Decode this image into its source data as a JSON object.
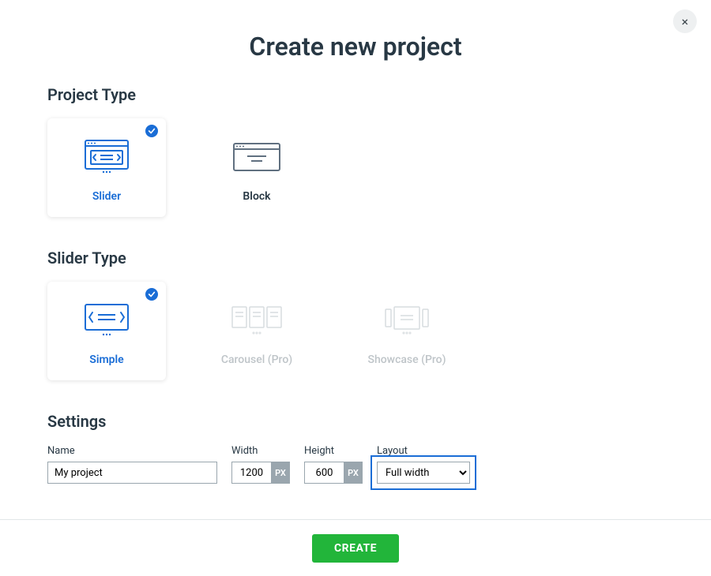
{
  "title": "Create new project",
  "close_icon": "×",
  "sections": {
    "project_type": {
      "heading": "Project Type",
      "options": [
        {
          "label": "Slider",
          "selected": true
        },
        {
          "label": "Block",
          "selected": false
        }
      ]
    },
    "slider_type": {
      "heading": "Slider Type",
      "options": [
        {
          "label": "Simple",
          "selected": true,
          "disabled": false
        },
        {
          "label": "Carousel (Pro)",
          "selected": false,
          "disabled": true
        },
        {
          "label": "Showcase (Pro)",
          "selected": false,
          "disabled": true
        }
      ]
    },
    "settings": {
      "heading": "Settings",
      "name": {
        "label": "Name",
        "value": "My project"
      },
      "width": {
        "label": "Width",
        "value": "1200",
        "suffix": "PX"
      },
      "height": {
        "label": "Height",
        "value": "600",
        "suffix": "PX"
      },
      "layout": {
        "label": "Layout",
        "value": "Full width",
        "options": [
          "Full width"
        ]
      }
    }
  },
  "footer": {
    "create_label": "CREATE"
  }
}
